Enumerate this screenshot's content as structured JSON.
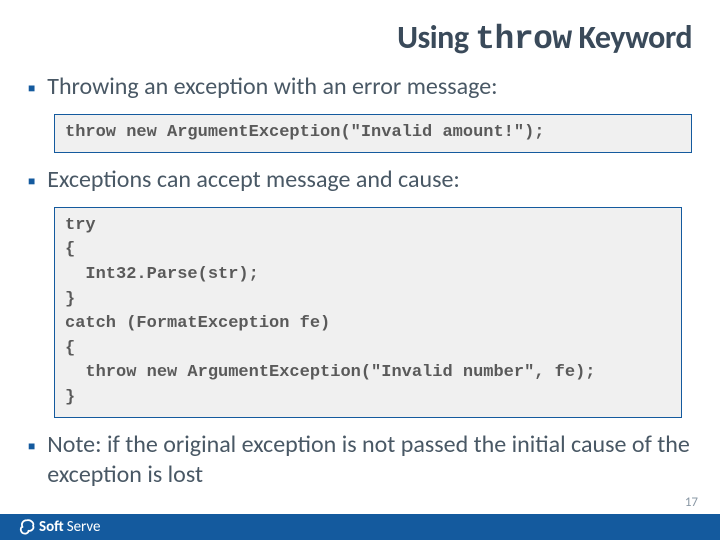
{
  "title_prefix": "Using ",
  "title_keyword": "throw",
  "title_suffix": " Keyword",
  "bullets": {
    "b1": "Throwing an exception with an error message:",
    "b2": "Exceptions can accept message and cause:",
    "b3": "Note: if the original exception is not passed the initial cause of the exception is lost"
  },
  "code1": "throw new ArgumentException(\"Invalid amount!\");",
  "code2": "try\n{\n  Int32.Parse(str);\n}\ncatch (FormatException fe)\n{\n  throw new ArgumentException(\"Invalid number\", fe);\n}",
  "footer": {
    "brand_left": "Soft",
    "brand_right": "Serve"
  },
  "page_number": "17"
}
